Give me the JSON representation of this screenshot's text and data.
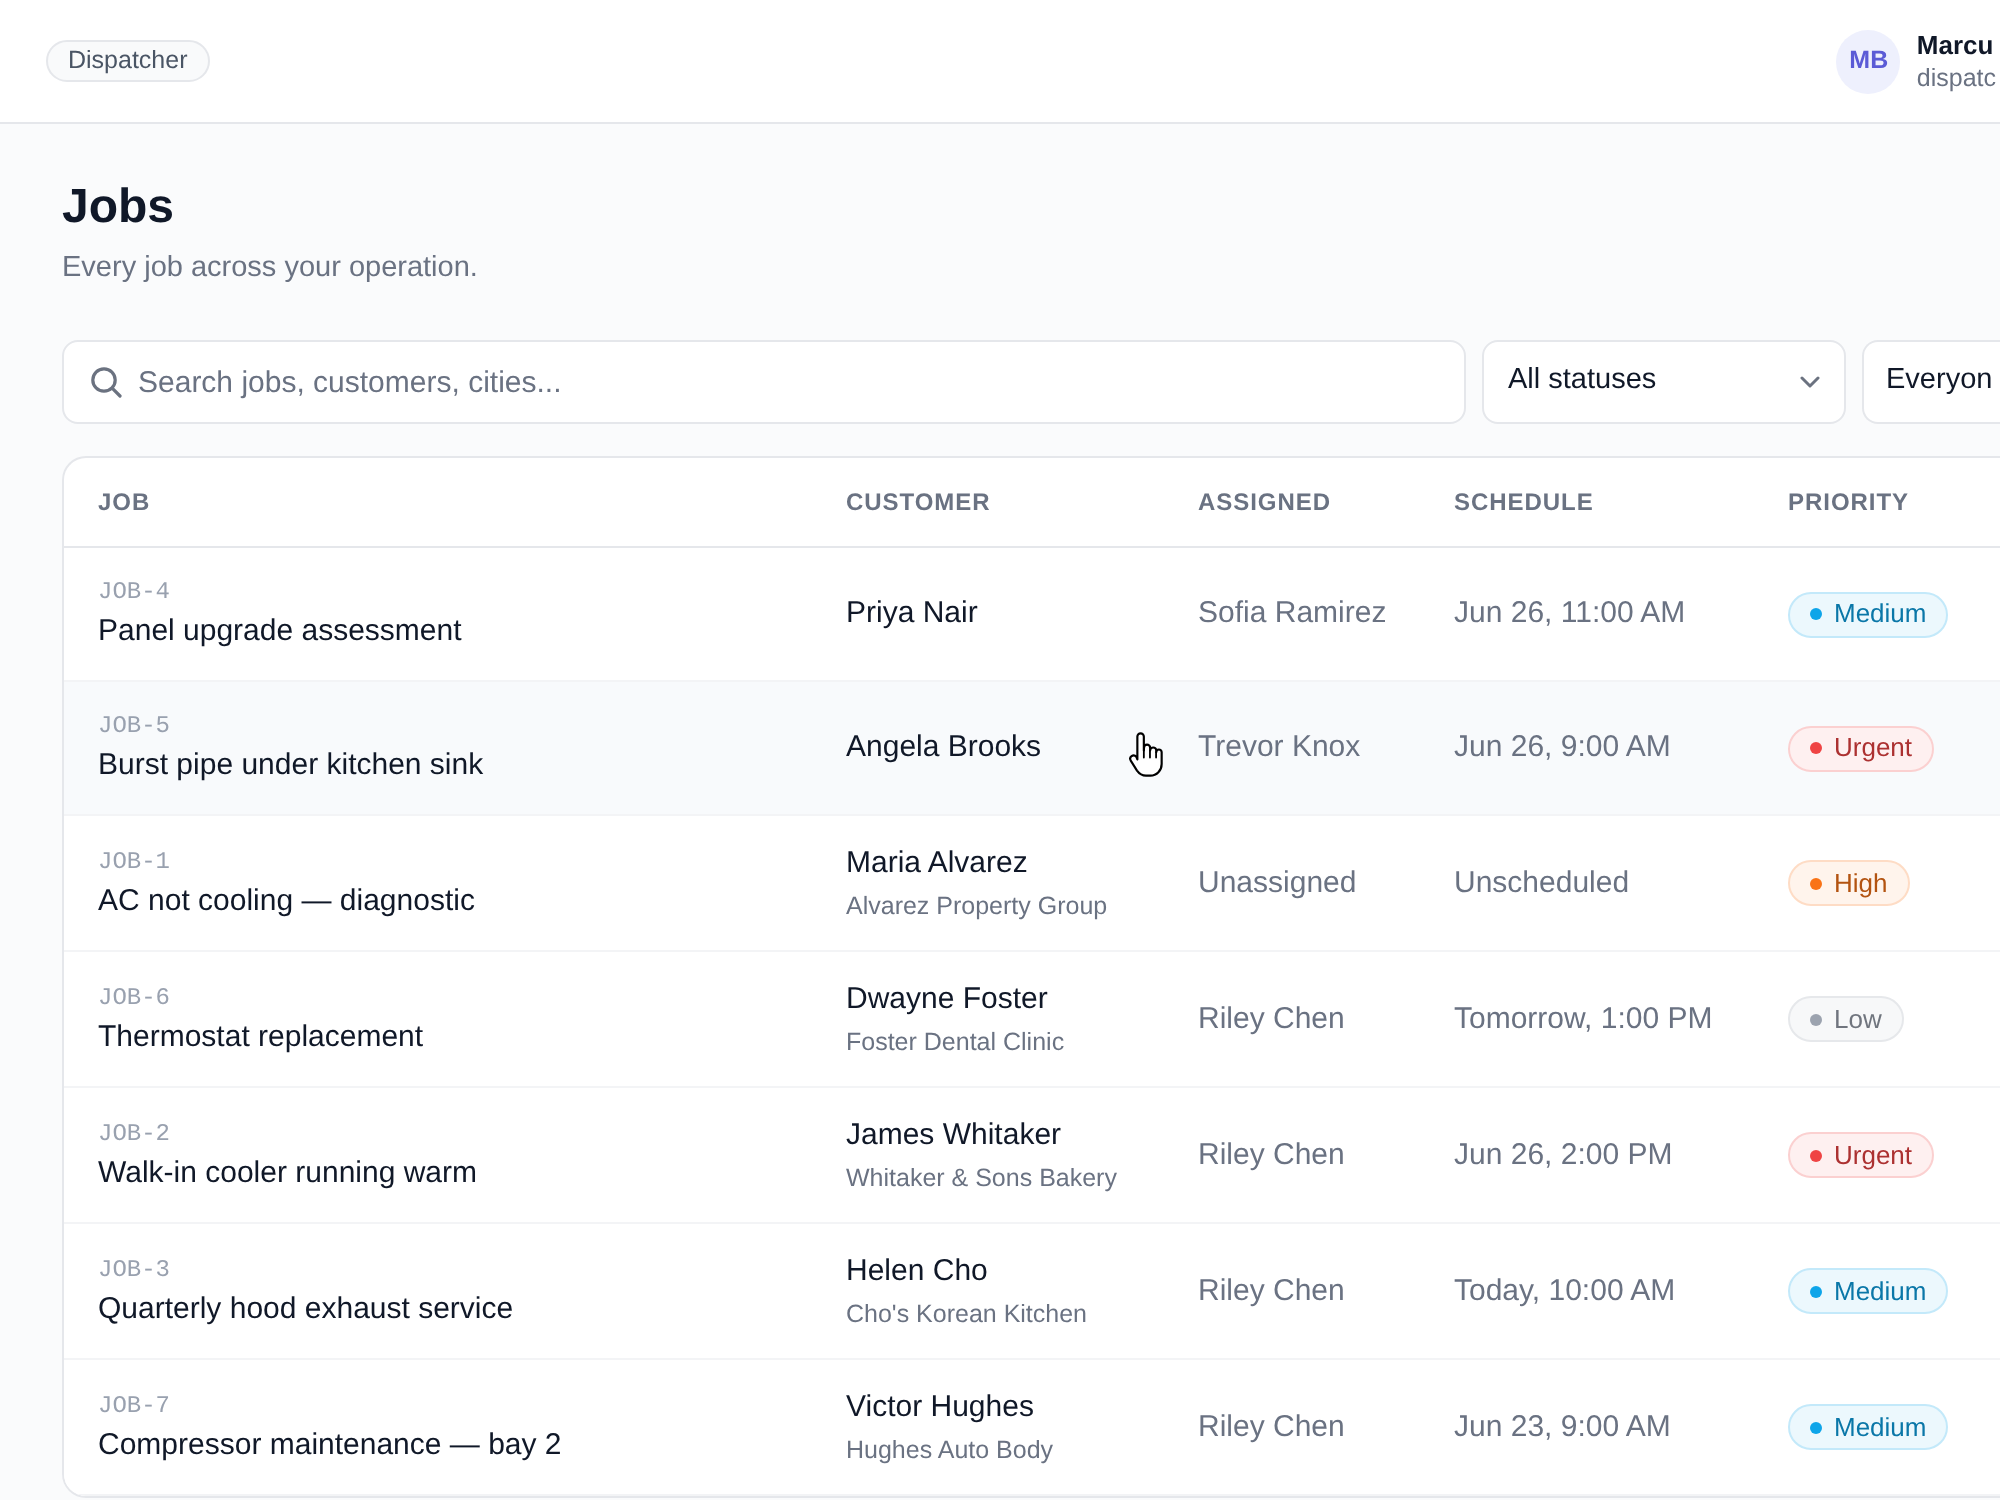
{
  "header": {
    "role": "Dispatcher",
    "user": {
      "initials": "MB",
      "name": "Marcu",
      "role": "dispatc"
    }
  },
  "page": {
    "title": "Jobs",
    "subtitle": "Every job across your operation."
  },
  "filters": {
    "search": {
      "placeholder": "Search jobs, customers, cities..."
    },
    "status": {
      "value": "All statuses"
    },
    "assignee": {
      "value": "Everyon"
    }
  },
  "table": {
    "columns": [
      "JOB",
      "CUSTOMER",
      "ASSIGNED",
      "SCHEDULE",
      "PRIORITY"
    ],
    "rows": [
      {
        "id": "JOB-4",
        "title": "Panel upgrade assessment",
        "customer": "Priya Nair",
        "assigned": "Sofia Ramirez",
        "schedule": "Jun 26, 11:00 AM",
        "priority": {
          "label": "Medium",
          "color": "#0ea5e9"
        },
        "hovered": false
      },
      {
        "id": "JOB-5",
        "title": "Burst pipe under kitchen sink",
        "customer": "Angela Brooks",
        "assigned": "Trevor Knox",
        "schedule": "Jun 26, 9:00 AM",
        "priority": {
          "label": "Urgent",
          "color": "#ef4444"
        },
        "hovered": true
      },
      {
        "id": "JOB-1",
        "title": "AC not cooling — diagnostic",
        "customer": "Maria Alvarez",
        "company": "Alvarez Property Group",
        "assigned": "Unassigned",
        "schedule": "Unscheduled",
        "priority": {
          "label": "High",
          "color": "#f97316"
        },
        "hovered": false
      },
      {
        "id": "JOB-6",
        "title": "Thermostat replacement",
        "customer": "Dwayne Foster",
        "company": "Foster Dental Clinic",
        "assigned": "Riley Chen",
        "schedule": "Tomorrow, 1:00 PM",
        "priority": {
          "label": "Low",
          "color": "#9ca3af"
        },
        "hovered": false
      },
      {
        "id": "JOB-2",
        "title": "Walk-in cooler running warm",
        "customer": "James Whitaker",
        "company": "Whitaker & Sons Bakery",
        "assigned": "Riley Chen",
        "schedule": "Jun 26, 2:00 PM",
        "priority": {
          "label": "Urgent",
          "color": "#ef4444"
        },
        "hovered": false
      },
      {
        "id": "JOB-3",
        "title": "Quarterly hood exhaust service",
        "customer": "Helen Cho",
        "company": "Cho's Korean Kitchen",
        "assigned": "Riley Chen",
        "schedule": "Today, 10:00 AM",
        "priority": {
          "label": "Medium",
          "color": "#0ea5e9"
        },
        "hovered": false
      },
      {
        "id": "JOB-7",
        "title": "Compressor maintenance — bay 2",
        "customer": "Victor Hughes",
        "company": "Hughes Auto Body",
        "assigned": "Riley Chen",
        "schedule": "Jun 23, 9:00 AM",
        "priority": {
          "label": "Medium",
          "color": "#0ea5e9"
        },
        "hovered": false
      }
    ]
  }
}
